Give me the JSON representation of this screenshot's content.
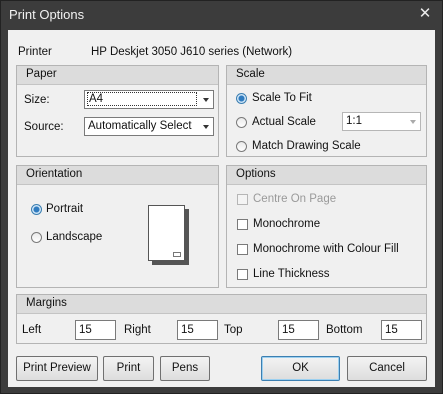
{
  "window": {
    "title": "Print Options"
  },
  "printer": {
    "label": "Printer",
    "name": "HP Deskjet 3050 J610 series (Network)"
  },
  "paper": {
    "heading": "Paper",
    "size_label": "Size:",
    "size_value": "A4",
    "source_label": "Source:",
    "source_value": "Automatically Select"
  },
  "scale": {
    "heading": "Scale",
    "options": [
      "Scale To Fit",
      "Actual Scale",
      "Match Drawing Scale"
    ],
    "selected": "Scale To Fit",
    "ratio_value": "1:1"
  },
  "orientation": {
    "heading": "Orientation",
    "options": [
      "Portrait",
      "Landscape"
    ],
    "selected": "Portrait"
  },
  "options": {
    "heading": "Options",
    "items": [
      "Centre On Page",
      "Monochrome",
      "Monochrome with Colour Fill",
      "Line Thickness"
    ]
  },
  "margins": {
    "heading": "Margins",
    "left_label": "Left",
    "left_value": "15",
    "right_label": "Right",
    "right_value": "15",
    "top_label": "Top",
    "top_value": "15",
    "bottom_label": "Bottom",
    "bottom_value": "15"
  },
  "buttons": {
    "print_preview": "Print Preview",
    "print": "Print",
    "pens": "Pens",
    "ok": "OK",
    "cancel": "Cancel"
  },
  "icons": {
    "close": "close-icon",
    "dropdown": "chevron-down-icon"
  },
  "colors": {
    "titlebar": "#3c3c3c",
    "client": "#f0f0f0",
    "accent": "#3c7fb1"
  }
}
